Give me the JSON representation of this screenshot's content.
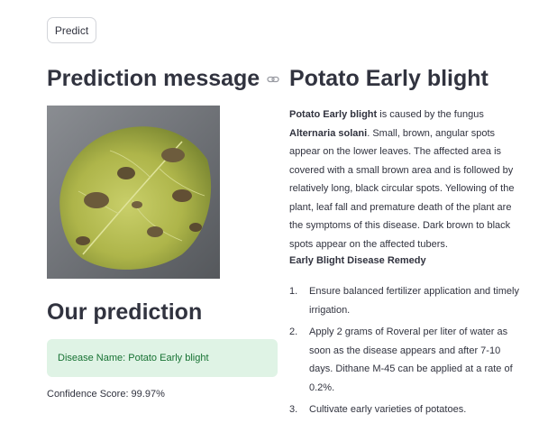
{
  "toolbar": {
    "predict_label": "Predict"
  },
  "left": {
    "heading": "Prediction message",
    "link_icon": "link-icon",
    "image_icon": "potato-leaf-image",
    "prediction_heading": "Our prediction",
    "disease_message": "Disease Name: Potato Early blight",
    "confidence": "Confidence Score: 99.97%"
  },
  "right": {
    "title": "Potato Early blight",
    "desc_disease": "Potato Early blight",
    "desc_part1": " is caused by the fungus ",
    "desc_fungus": "Alternaria solani",
    "desc_part2": ". Small, brown, angular spots appear on the lower leaves. The affected area is covered with a small brown area and is followed by relatively long, black circular spots. Yellowing of the plant, leaf fall and premature death of the plant are the symptoms of this disease. Dark brown to black spots appear on the affected tubers.",
    "remedy_title": "Early Blight Disease Remedy",
    "remedies": [
      {
        "num": "1.",
        "text": "Ensure balanced fertilizer application and timely irrigation."
      },
      {
        "num": "2.",
        "text": "Apply 2 grams of Roveral per liter of water as soon as the disease appears and after 7-10 days. Dithane M-45 can be applied at a rate of 0.2%."
      },
      {
        "num": "3.",
        "text": "Cultivate early varieties of potatoes."
      }
    ]
  },
  "colors": {
    "text": "#31333f",
    "success_bg": "#dff3e5",
    "success_text": "#177233",
    "button_border": "#d3d5da"
  }
}
